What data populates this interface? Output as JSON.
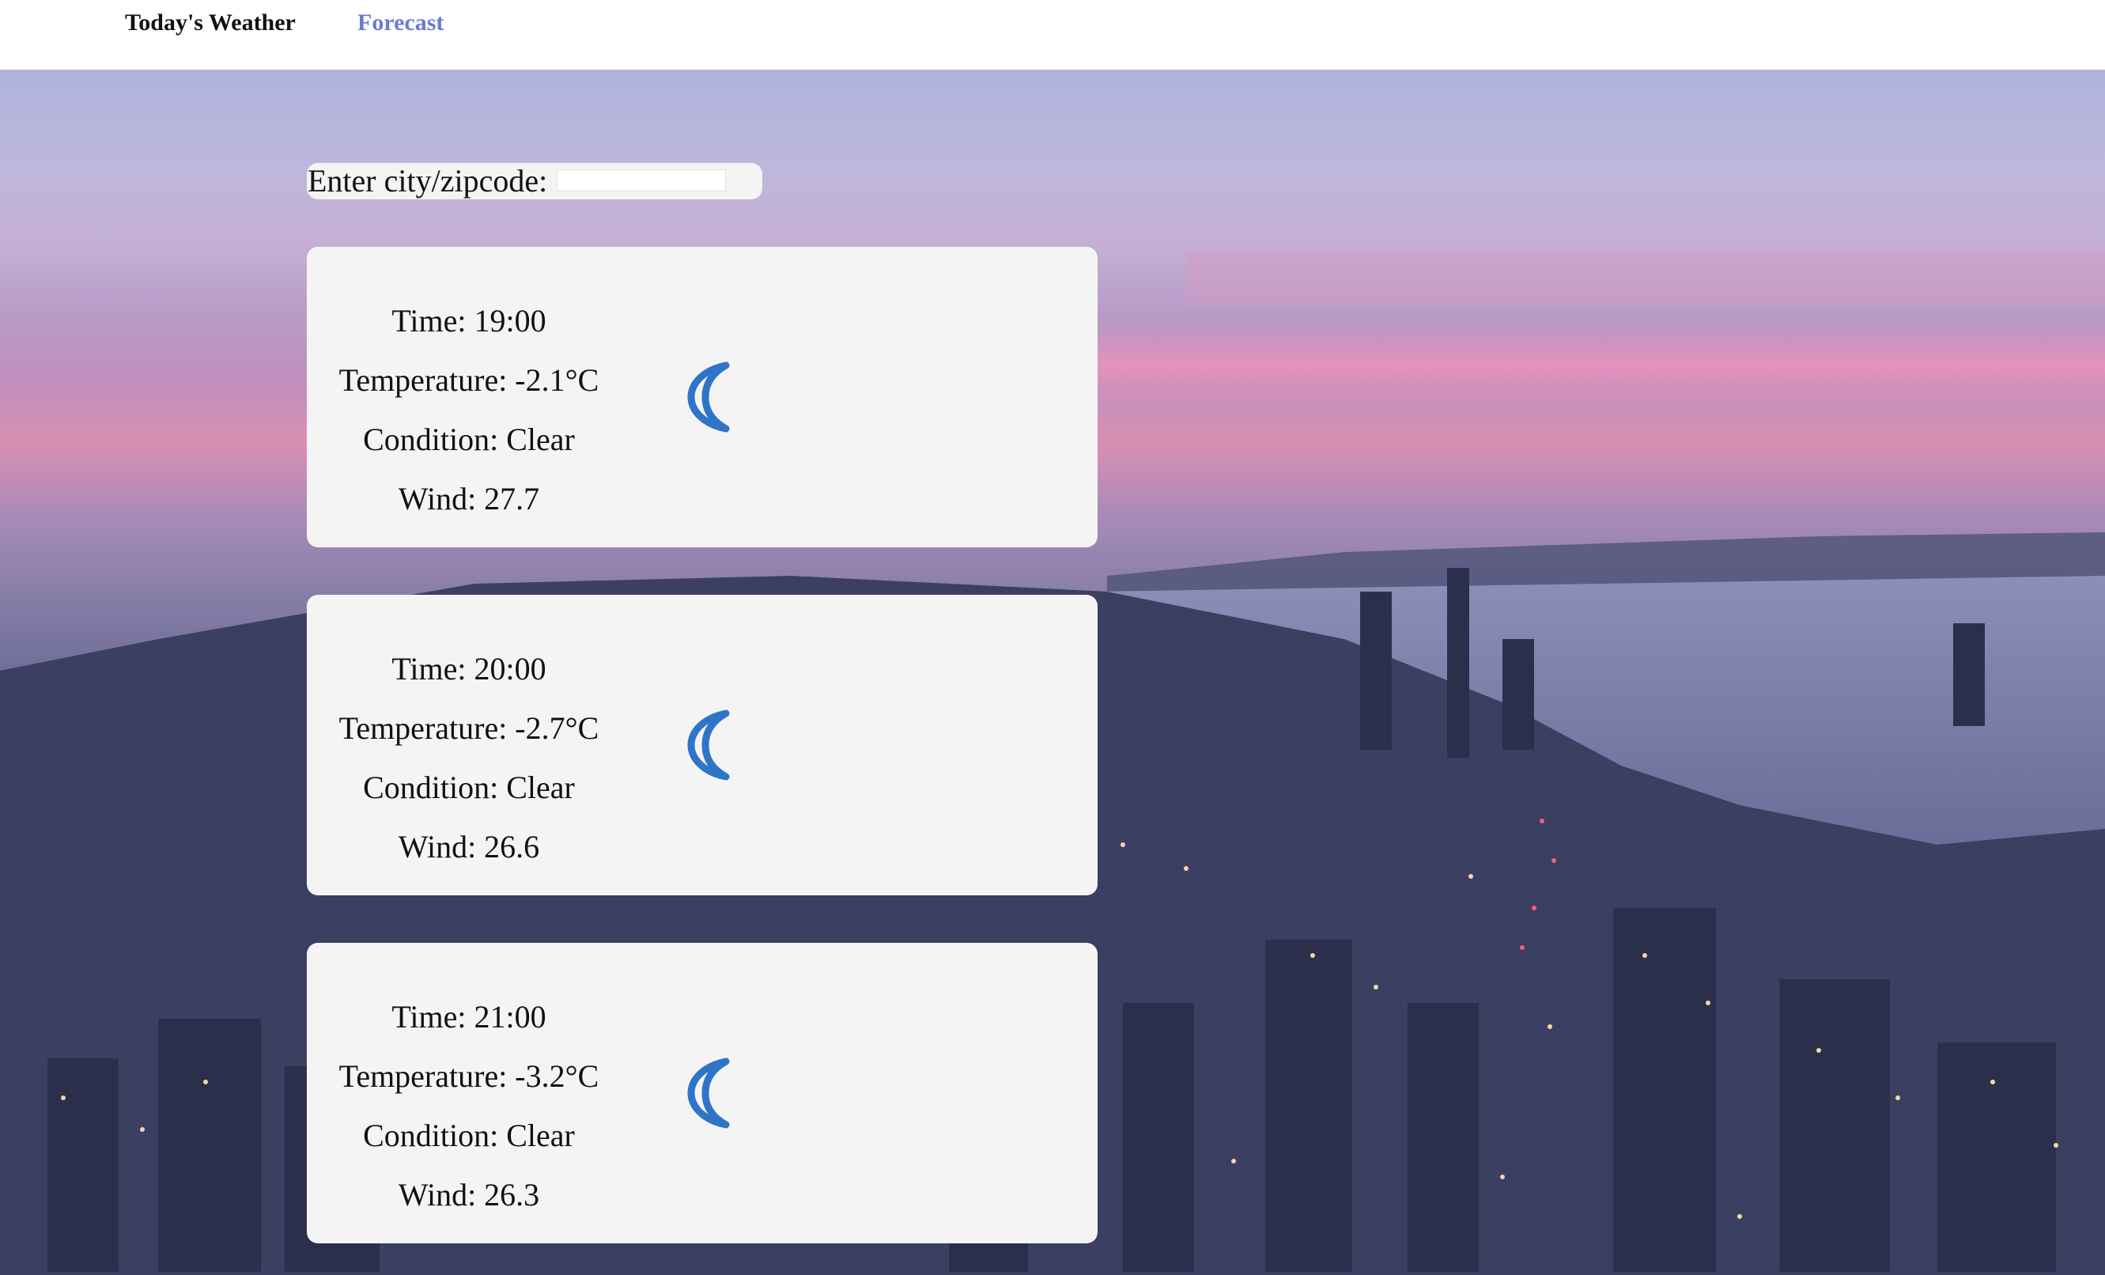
{
  "nav": {
    "today_label": "Today's Weather",
    "forecast_label": "Forecast"
  },
  "search": {
    "label": "Enter city/zipcode:",
    "value": "",
    "placeholder": ""
  },
  "forecast": [
    {
      "time": "Time: 19:00",
      "temperature": "Temperature: -2.1°C",
      "condition": "Condition: Clear",
      "wind": "Wind: 27.7",
      "icon": "moon-icon"
    },
    {
      "time": "Time: 20:00",
      "temperature": "Temperature: -2.7°C",
      "condition": "Condition: Clear",
      "wind": "Wind: 26.6",
      "icon": "moon-icon"
    },
    {
      "time": "Time: 21:00",
      "temperature": "Temperature: -3.2°C",
      "condition": "Condition: Clear",
      "wind": "Wind: 26.3",
      "icon": "moon-icon"
    }
  ],
  "colors": {
    "nav_active": "#6a7bd4",
    "nav_text": "#111111",
    "card_bg": "#f4f4f5",
    "moon_icon": "#2f74c8"
  }
}
